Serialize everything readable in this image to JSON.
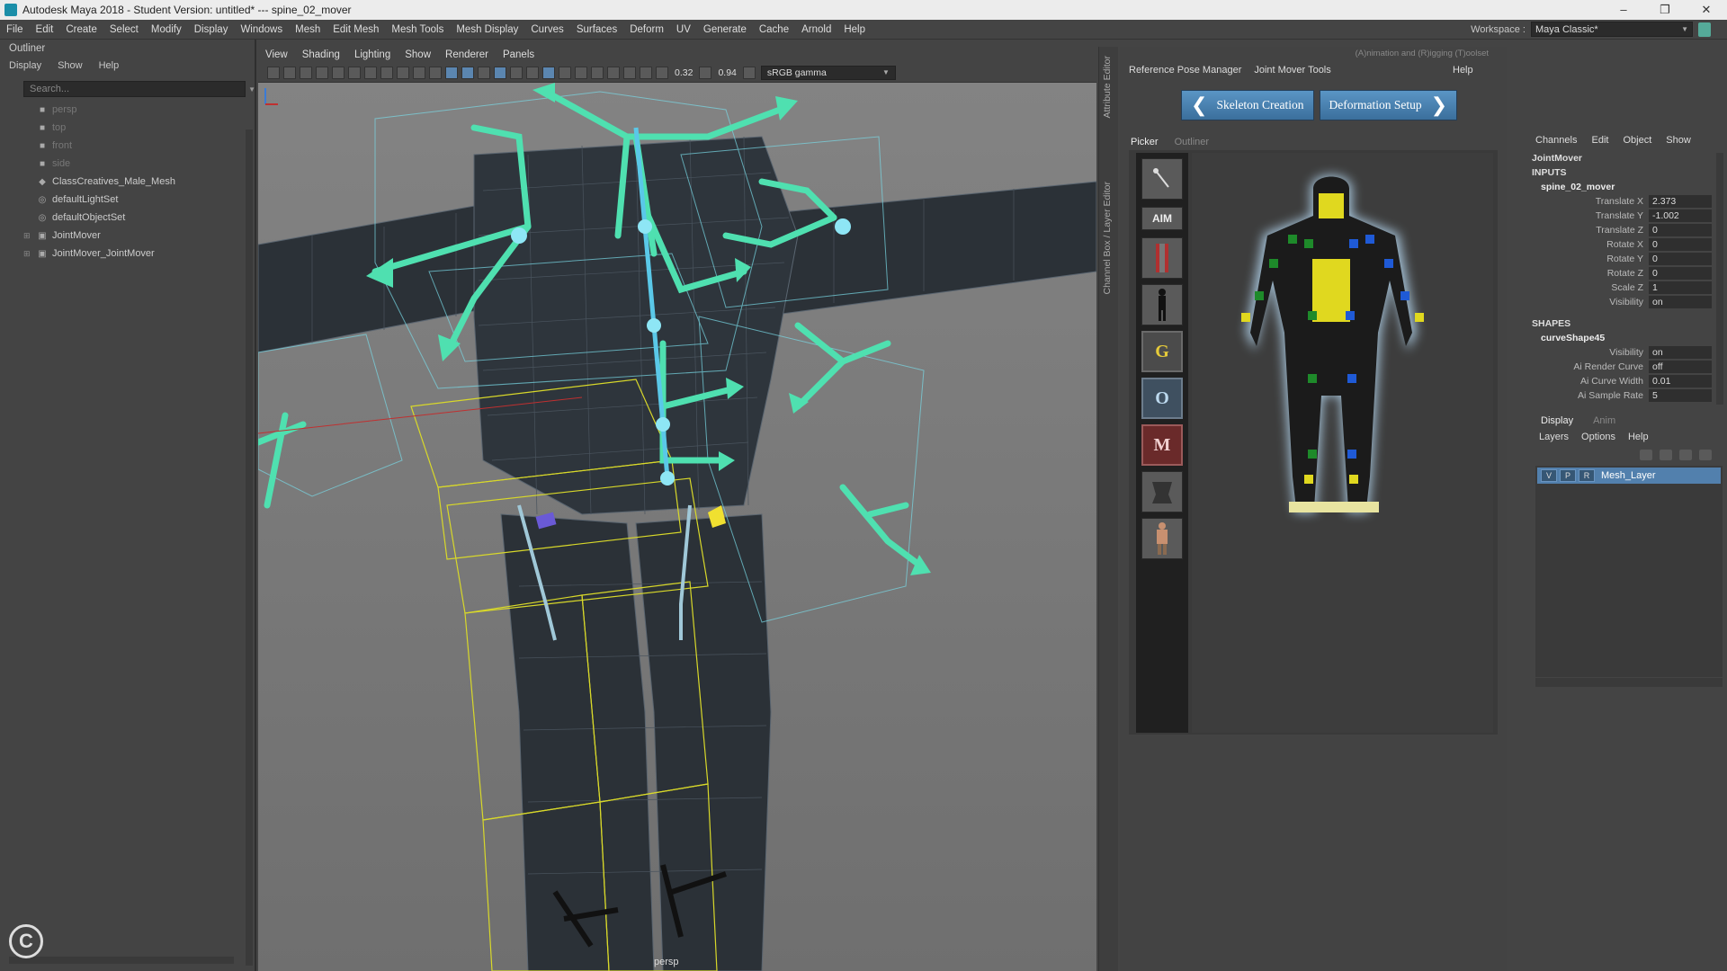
{
  "title_bar": {
    "title": "Autodesk Maya 2018 - Student Version: untitled*    ---    spine_02_mover",
    "minimize": "–",
    "maximize": "❐",
    "close": "✕"
  },
  "menubar": {
    "items": [
      "File",
      "Edit",
      "Create",
      "Select",
      "Modify",
      "Display",
      "Windows",
      "Mesh",
      "Edit Mesh",
      "Mesh Tools",
      "Mesh Display",
      "Curves",
      "Surfaces",
      "Deform",
      "UV",
      "Generate",
      "Cache",
      "Arnold",
      "Help"
    ],
    "workspace_label": "Workspace :",
    "workspace_value": "Maya Classic*"
  },
  "outliner": {
    "title": "Outliner",
    "menu": [
      "Display",
      "Show",
      "Help"
    ],
    "search_placeholder": "Search...",
    "items": [
      {
        "label": "persp",
        "icon": "camera-icon",
        "dim": true
      },
      {
        "label": "top",
        "icon": "camera-icon",
        "dim": true
      },
      {
        "label": "front",
        "icon": "camera-icon",
        "dim": true
      },
      {
        "label": "side",
        "icon": "camera-icon",
        "dim": true
      },
      {
        "label": "ClassCreatives_Male_Mesh",
        "icon": "mesh-icon",
        "dim": false
      },
      {
        "label": "defaultLightSet",
        "icon": "set-icon",
        "dim": false
      },
      {
        "label": "defaultObjectSet",
        "icon": "set-icon",
        "dim": false
      },
      {
        "label": "JointMover",
        "icon": "group-icon",
        "dim": false,
        "expandable": true
      },
      {
        "label": "JointMover_JointMover",
        "icon": "group-icon",
        "dim": false,
        "expandable": true
      }
    ]
  },
  "viewport": {
    "menu": [
      "View",
      "Shading",
      "Lighting",
      "Show",
      "Renderer",
      "Panels"
    ],
    "exposure": "0.32",
    "gamma": "0.94",
    "color_space": "sRGB gamma",
    "camera_label": "persp",
    "colors": {
      "mover": "#4fe0b0",
      "box": "#d8d82a",
      "mesh": "#2b3137",
      "joint": "#5ac8e8"
    }
  },
  "side_tabs": [
    "Attribute Editor",
    "Channel Box / Layer Editor"
  ],
  "art": {
    "header_note": "(A)nimation and (R)igging (T)oolset",
    "menu": [
      "Reference Pose Manager",
      "Joint Mover Tools",
      "Help"
    ],
    "nav_prev": "Skeleton Creation",
    "nav_next": "Deformation Setup",
    "tabs": [
      "Picker",
      "Outliner"
    ],
    "tool_buttons": [
      "pose-icon",
      "AIM",
      "torso-icon",
      "figure-icon",
      "G",
      "O",
      "M",
      "hands-icon",
      "body-icon"
    ],
    "colors": {
      "yellow": "#e0d81f",
      "green": "#1e8a2a",
      "blue": "#1f5ad6",
      "glow": "#bfe4ff"
    }
  },
  "channels": {
    "menu": [
      "Channels",
      "Edit",
      "Object",
      "Show"
    ],
    "object": "JointMover",
    "inputs_label": "INPUTS",
    "input_node": "spine_02_mover",
    "attributes": [
      {
        "label": "Translate X",
        "value": "2.373"
      },
      {
        "label": "Translate Y",
        "value": "-1.002"
      },
      {
        "label": "Translate Z",
        "value": "0"
      },
      {
        "label": "Rotate X",
        "value": "0"
      },
      {
        "label": "Rotate Y",
        "value": "0"
      },
      {
        "label": "Rotate Z",
        "value": "0"
      },
      {
        "label": "Scale Z",
        "value": "1"
      },
      {
        "label": "Visibility",
        "value": "on"
      }
    ],
    "shapes_label": "SHAPES",
    "shape_node": "curveShape45",
    "shape_attributes": [
      {
        "label": "Visibility",
        "value": "on"
      },
      {
        "label": "Ai Render Curve",
        "value": "off"
      },
      {
        "label": "Ai Curve Width",
        "value": "0.01"
      },
      {
        "label": "Ai Sample Rate",
        "value": "5"
      }
    ]
  },
  "layers": {
    "tabs": [
      "Display",
      "Anim"
    ],
    "menu": [
      "Layers",
      "Options",
      "Help"
    ],
    "layer": {
      "v": "V",
      "p": "P",
      "r": "R",
      "name": "Mesh_Layer"
    }
  }
}
